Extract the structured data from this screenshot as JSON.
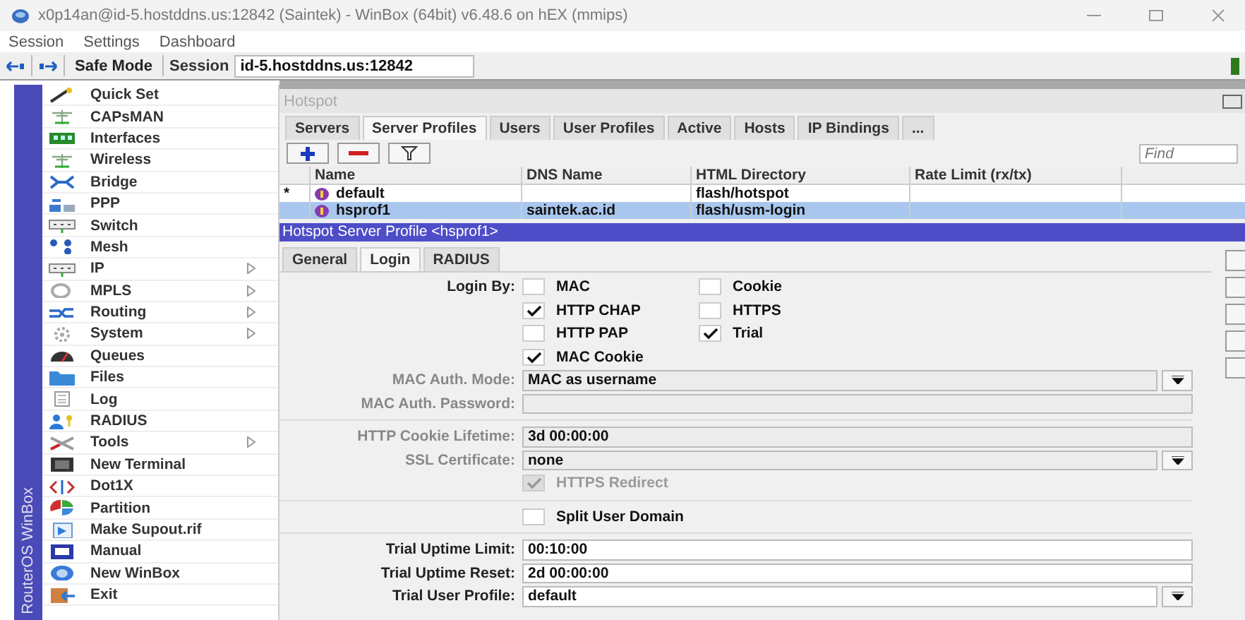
{
  "window": {
    "title": "x0p14an@id-5.hostddns.us:12842 (Saintek) - WinBox (64bit) v6.48.6 on hEX (mmips)"
  },
  "menu_bar": [
    "Session",
    "Settings",
    "Dashboard"
  ],
  "toolbar": {
    "safe_mode": "Safe Mode",
    "session_label": "Session",
    "session_value": "id-5.hostddns.us:12842"
  },
  "sidebar": {
    "brand": "RouterOS WinBox",
    "items": [
      {
        "label": "Quick Set",
        "submenu": false
      },
      {
        "label": "CAPsMAN",
        "submenu": false
      },
      {
        "label": "Interfaces",
        "submenu": false
      },
      {
        "label": "Wireless",
        "submenu": false
      },
      {
        "label": "Bridge",
        "submenu": false
      },
      {
        "label": "PPP",
        "submenu": false
      },
      {
        "label": "Switch",
        "submenu": false
      },
      {
        "label": "Mesh",
        "submenu": false
      },
      {
        "label": "IP",
        "submenu": true
      },
      {
        "label": "MPLS",
        "submenu": true
      },
      {
        "label": "Routing",
        "submenu": true
      },
      {
        "label": "System",
        "submenu": true
      },
      {
        "label": "Queues",
        "submenu": false
      },
      {
        "label": "Files",
        "submenu": false
      },
      {
        "label": "Log",
        "submenu": false
      },
      {
        "label": "RADIUS",
        "submenu": false
      },
      {
        "label": "Tools",
        "submenu": true
      },
      {
        "label": "New Terminal",
        "submenu": false
      },
      {
        "label": "Dot1X",
        "submenu": false
      },
      {
        "label": "Partition",
        "submenu": false
      },
      {
        "label": "Make Supout.rif",
        "submenu": false
      },
      {
        "label": "Manual",
        "submenu": false
      },
      {
        "label": "New WinBox",
        "submenu": false
      },
      {
        "label": "Exit",
        "submenu": false
      }
    ]
  },
  "hotspot": {
    "title": "Hotspot",
    "tabs": [
      {
        "label": "Servers",
        "selected": false
      },
      {
        "label": "Server Profiles",
        "selected": true
      },
      {
        "label": "Users",
        "selected": false
      },
      {
        "label": "User Profiles",
        "selected": false
      },
      {
        "label": "Active",
        "selected": false
      },
      {
        "label": "Hosts",
        "selected": false
      },
      {
        "label": "IP Bindings",
        "selected": false
      },
      {
        "label": "...",
        "selected": false
      }
    ],
    "find_placeholder": "Find",
    "columns": [
      "Name",
      "DNS Name",
      "HTML Directory",
      "Rate Limit (rx/tx)"
    ],
    "rows": [
      {
        "marker": "*",
        "name": "default",
        "dns_name": "",
        "html_directory": "flash/hotspot",
        "selected": false
      },
      {
        "marker": "",
        "name": "hsprof1",
        "dns_name": "saintek.ac.id",
        "html_directory": "flash/usm-login",
        "selected": true
      }
    ]
  },
  "profile": {
    "title": "Hotspot Server Profile <hsprof1>",
    "tabs": [
      {
        "label": "General",
        "selected": false
      },
      {
        "label": "Login",
        "selected": true
      },
      {
        "label": "RADIUS",
        "selected": false
      }
    ],
    "login_by_label": "Login By:",
    "login_by": [
      {
        "label": "MAC",
        "checked": false
      },
      {
        "label": "Cookie",
        "checked": false
      },
      {
        "label": "HTTP CHAP",
        "checked": true
      },
      {
        "label": "HTTPS",
        "checked": false
      },
      {
        "label": "HTTP PAP",
        "checked": false
      },
      {
        "label": "Trial",
        "checked": true
      },
      {
        "label": "MAC Cookie",
        "checked": true
      }
    ],
    "fields": [
      {
        "kind": "select",
        "label": "MAC Auth. Mode:",
        "value": "MAC as username",
        "disabled": true
      },
      {
        "kind": "text",
        "label": "MAC Auth. Password:",
        "disabled": true
      },
      {
        "kind": "separator"
      },
      {
        "kind": "text",
        "label": "HTTP Cookie Lifetime:",
        "value": "3d 00:00:00",
        "disabled": true
      },
      {
        "kind": "select",
        "label": "SSL Certificate:",
        "value": "none",
        "disabled": true
      },
      {
        "kind": "checkbox",
        "label": "HTTPS Redirect",
        "checked": true,
        "disabled": true
      },
      {
        "kind": "separator"
      },
      {
        "kind": "checkbox",
        "label": "Split User Domain",
        "checked": false,
        "disabled": false
      },
      {
        "kind": "separator"
      },
      {
        "kind": "text",
        "label": "Trial Uptime Limit:",
        "value": "00:10:00",
        "disabled": false
      },
      {
        "kind": "text",
        "label": "Trial Uptime Reset:",
        "value": "2d 00:00:00",
        "disabled": false
      },
      {
        "kind": "select",
        "label": "Trial User Profile:",
        "value": "default",
        "disabled": false
      }
    ]
  }
}
